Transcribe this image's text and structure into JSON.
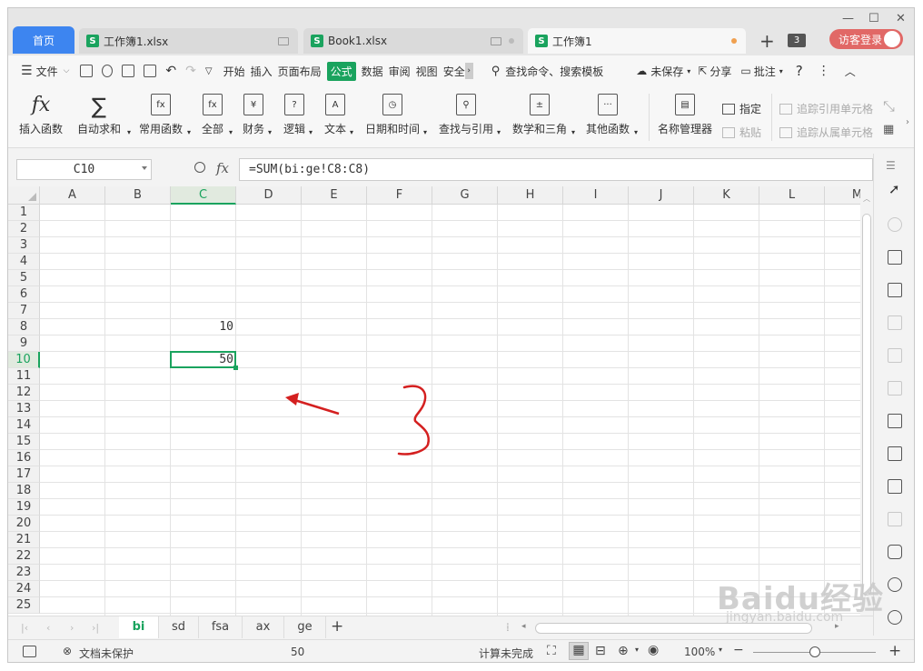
{
  "tabs": {
    "home": "首页",
    "docs": [
      {
        "title": "工作簿1.xlsx",
        "active": false
      },
      {
        "title": "Book1.xlsx",
        "active": false
      },
      {
        "title": "工作簿1",
        "active": true
      }
    ],
    "count_badge": "3",
    "login": "访客登录"
  },
  "menu": {
    "file": "文件",
    "items": [
      "开始",
      "插入",
      "页面布局",
      "公式",
      "数据",
      "审阅",
      "视图",
      "安全"
    ],
    "active_item": "公式",
    "search": "查找命令、搜索模板",
    "unsaved": "未保存",
    "share": "分享",
    "comment": "批注",
    "help": "?"
  },
  "ribbon": {
    "insert_fn": "插入函数",
    "autosum": "自动求和",
    "common_fn": "常用函数",
    "all": "全部",
    "finance": "财务",
    "logic": "逻辑",
    "text": "文本",
    "datetime": "日期和时间",
    "lookup": "查找与引用",
    "math": "数学和三角",
    "other": "其他函数",
    "name_mgr": "名称管理器",
    "specify": "指定",
    "paste": "粘贴",
    "trace_prec": "追踪引用单元格",
    "trace_dep": "追踪从属单元格"
  },
  "formula_bar": {
    "name_box": "C10",
    "fx": "fx",
    "formula": "=SUM(bi:ge!C8:C8)"
  },
  "grid": {
    "columns": [
      "A",
      "B",
      "C",
      "D",
      "E",
      "F",
      "G",
      "H",
      "I",
      "J",
      "K",
      "L",
      "M"
    ],
    "rows": [
      "1",
      "2",
      "3",
      "4",
      "5",
      "6",
      "7",
      "8",
      "9",
      "10",
      "11",
      "12",
      "13",
      "14",
      "15",
      "16",
      "17",
      "18",
      "19",
      "20",
      "21",
      "22",
      "23",
      "24",
      "25"
    ],
    "selected_col": "C",
    "selected_row": "10",
    "cells": {
      "C8": "10",
      "C10": "50"
    }
  },
  "annotation": {
    "color": "#d42020"
  },
  "sheets": [
    "bi",
    "sd",
    "fsa",
    "ax",
    "ge"
  ],
  "active_sheet": "bi",
  "status": {
    "protect": "文档未保护",
    "sum": "50",
    "calc": "计算未完成",
    "zoom": "100%"
  },
  "watermark": {
    "main": "Baidu经验",
    "sub": "jingyan.baidu.com"
  },
  "colors": {
    "green": "#1aa35e",
    "home_tab": "#3d85f0",
    "login": "#e16866"
  }
}
